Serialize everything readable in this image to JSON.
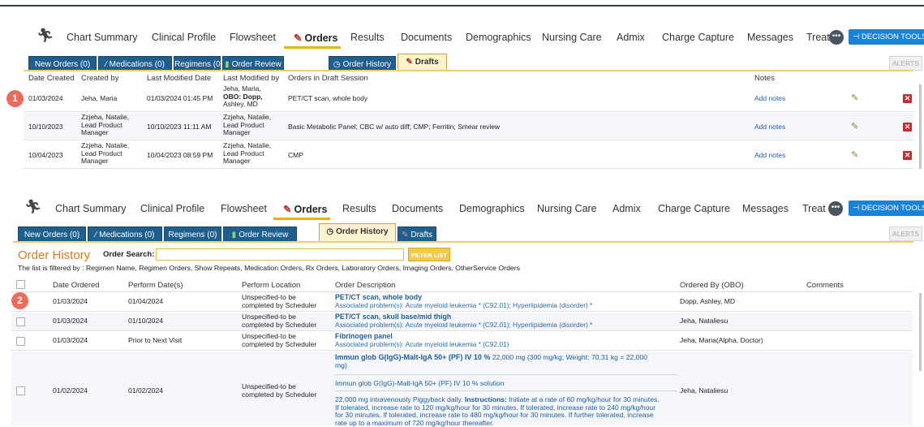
{
  "nav": {
    "tabs": [
      "Chart Summary",
      "Clinical Profile",
      "Flowsheet",
      "Orders",
      "Results",
      "Documents",
      "Demographics",
      "Nursing Care",
      "Admix",
      "Charge Capture",
      "Messages",
      "Treat"
    ],
    "more_label": "•••",
    "decision_tools": "⊣ DECISION TOOLS"
  },
  "subtabs": {
    "new_orders": "New Orders (0)",
    "medications": "Medications (0)",
    "regimens": "Regimens (0)",
    "order_review": "Order Review",
    "order_history": "Order History",
    "drafts": "Drafts",
    "alerts": "ALERTS"
  },
  "drafts_table": {
    "headers": [
      "Date Created",
      "Created by",
      "Last Modified Date",
      "Last Modified by",
      "Orders in Draft Session",
      "Notes"
    ],
    "rows": [
      {
        "date": "01/03/2024",
        "created_by": [
          "Jeha, Maria",
          ""
        ],
        "modified_date": "01/03/2024 01:45 PM",
        "modified_by": [
          "Jeha, Maria,",
          "OBO: Dopp,",
          "Ashley, MD"
        ],
        "orders": "PET/CT scan, whole body",
        "notes": "Add notes"
      },
      {
        "date": "10/10/2023",
        "created_by": [
          "Zzjeha, Natalie,",
          "Lead Product",
          "Manager"
        ],
        "modified_date": "10/10/2023 11:11 AM",
        "modified_by": [
          "Zzjeha, Natalie,",
          "Lead Product",
          "Manager"
        ],
        "orders": "Basic Metabolic Panel; CBC w/ auto diff; CMP; Ferritin; Smear review",
        "notes": "Add notes"
      },
      {
        "date": "10/04/2023",
        "created_by": [
          "Zzjeha, Natalie,",
          "Lead Product",
          "Manager"
        ],
        "modified_date": "10/04/2023 08:59 PM",
        "modified_by": [
          "Zzjeha, Natalie,",
          "Lead Product",
          "Manager"
        ],
        "orders": "CMP",
        "notes": "Add notes"
      }
    ]
  },
  "badges": {
    "one": "1",
    "two": "2"
  },
  "order_history": {
    "title": "Order History",
    "search_label": "Order Search:",
    "filter_button": "FILTER LIST",
    "filter_note": "The list is filtered by : Regimen Name, Regimen Orders, Show Repeats, Medication Orders, Rx Orders, Laboratory Orders, Imaging Orders, OtherService Orders",
    "headers": [
      "Date Ordered",
      "Perform Date(s)",
      "Perform Location",
      "Order Description",
      "Ordered By (OBO)",
      "Comments"
    ],
    "rows": [
      {
        "date": "01/03/2024",
        "perform": "01/04/2024",
        "location": [
          "Unspecified-to be",
          "completed by Scheduler"
        ],
        "desc_title": "PET/CT scan, whole body",
        "desc_sub": "Associated problem(s): Acute myeloid leukemia * (C92.01); Hyperlipidemia (disorder) *",
        "ordered_by": "Dopp, Ashley, MD"
      },
      {
        "date": "01/03/2024",
        "perform": "01/10/2024",
        "location": [
          "Unspecified-to be",
          "completed by Scheduler"
        ],
        "desc_title": "PET/CT scan, skull base/mid thigh",
        "desc_sub": "Associated problem(s): Acute myeloid leukemia * (C92.01); Hyperlipidemia (disorder) *",
        "ordered_by": "Jeha, Nataliesu"
      },
      {
        "date": "01/03/2024",
        "perform": "Prior to Next Visit",
        "location": [
          "Unspecified-to be",
          "completed by Scheduler"
        ],
        "desc_title": "Fibrinogen panel",
        "desc_sub": "Associated problem(s): Acute myeloid leukemia * (C92.01)",
        "ordered_by": "Jeha, Maria(Alpha, Doctor)"
      },
      {
        "date": "01/02/2024",
        "perform": "01/02/2024",
        "location": [
          "Unspecified-to be",
          "completed by Scheduler"
        ],
        "desc_title_bold": "Immun glob G(IgG)-Malt-IgA 50+ (PF) IV 10 %",
        "desc_title_rest": " 22,000 mg (300 mg/kg; Weight: 70.31 kg = 22,000",
        "desc_title_rest2": "mg)",
        "desc_line2": "Immun glob G(IgG)-Malt-IgA 50+ (PF) IV 10 % solution",
        "desc_line3_pre": "22,000 mg intravenously Piggyback daily.",
        "desc_line3_bold": "Instructions:",
        "desc_line3_post": "Initiate at a rate of 60 mg/kg/hour for 30 minutes.",
        "desc_line4": "If tolerated, increase rate to 120 mg/kg/hour for 30 minutes. If tolerated, increase rate to 240 mg/kg/hour",
        "desc_line5": "for 30 minutes. If tolerated, increase rate to 480 mg/kg/hour for 30 minutes. If further tolerated, increase",
        "desc_line6": "rate up to a maximum of 720 mg/kg/hour thereafter.",
        "ordered_by": "Jeha, Nataliesu"
      }
    ]
  }
}
